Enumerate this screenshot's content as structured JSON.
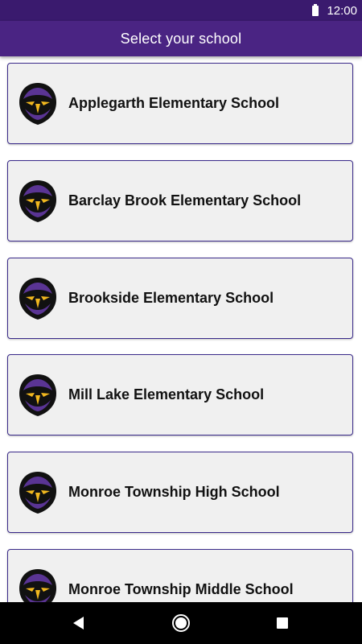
{
  "status_bar": {
    "time": "12:00",
    "battery_icon": "battery-full-icon"
  },
  "header": {
    "title": "Select your school"
  },
  "schools": [
    {
      "name": "Applegarth Elementary School",
      "logo_icon": "hawk-mascot-icon"
    },
    {
      "name": "Barclay Brook Elementary School",
      "logo_icon": "hawk-mascot-icon"
    },
    {
      "name": "Brookside Elementary School",
      "logo_icon": "hawk-mascot-icon"
    },
    {
      "name": "Mill Lake Elementary School",
      "logo_icon": "hawk-mascot-icon"
    },
    {
      "name": "Monroe Township High School",
      "logo_icon": "hawk-mascot-icon"
    },
    {
      "name": "Monroe Township Middle School",
      "logo_icon": "hawk-mascot-icon"
    }
  ],
  "nav_bar": {
    "back_icon": "back-triangle-icon",
    "home_icon": "home-circle-icon",
    "recents_icon": "recents-square-icon"
  },
  "colors": {
    "status_bar": "#3a1a6e",
    "app_bar": "#4a2483",
    "card_background": "#f0f0f0",
    "card_border": "#3a2a8a",
    "logo_purple": "#4b2a82",
    "logo_gold": "#f2b81f"
  }
}
